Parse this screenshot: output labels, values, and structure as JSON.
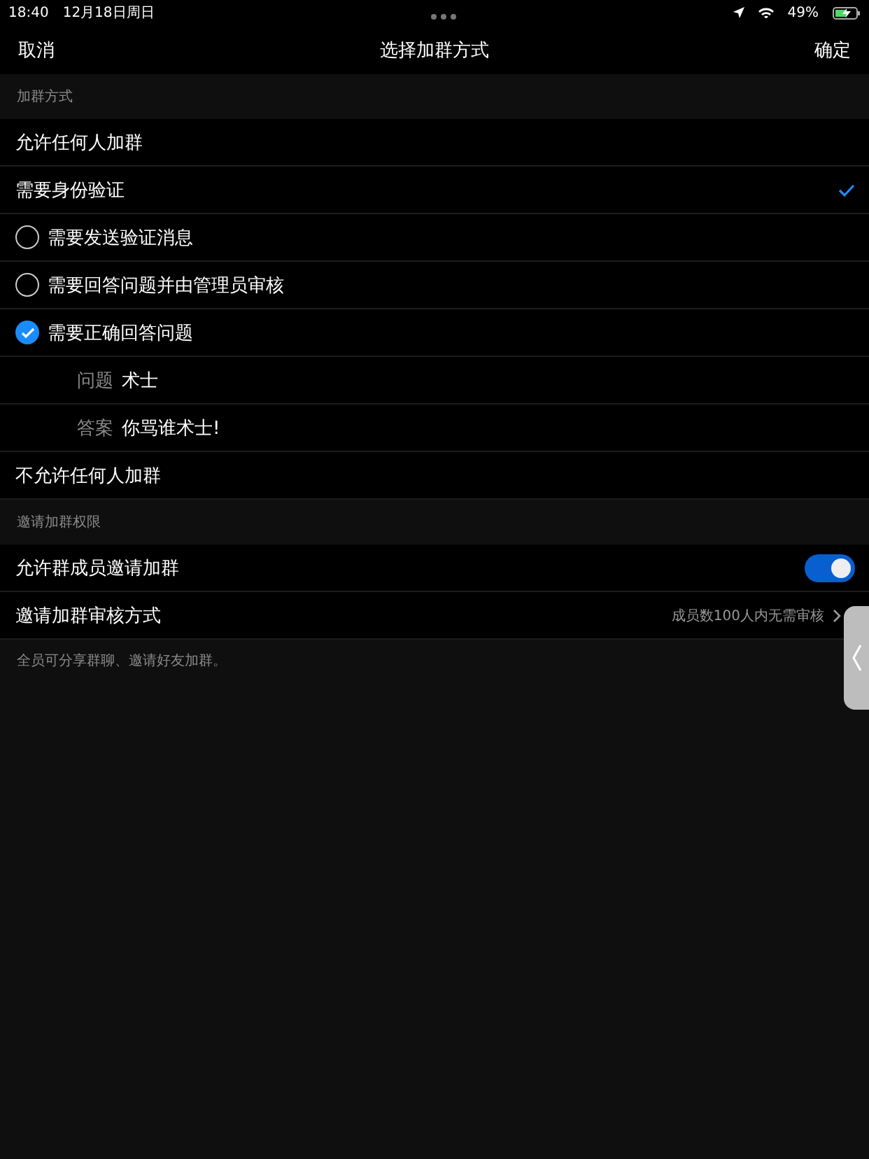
{
  "status_bar": {
    "time": "18:40",
    "date": "12月18日周日",
    "battery": "49%"
  },
  "nav": {
    "cancel": "取消",
    "title": "选择加群方式",
    "confirm": "确定"
  },
  "join_section": {
    "header": "加群方式",
    "options": [
      {
        "label": "允许任何人加群",
        "selected": false
      },
      {
        "label": "需要身份验证",
        "selected": true,
        "sub_options": [
          {
            "label": "需要发送验证消息",
            "selected": false
          },
          {
            "label": "需要回答问题并由管理员审核",
            "selected": false
          },
          {
            "label": "需要正确回答问题",
            "selected": true,
            "fields": [
              {
                "label": "问题",
                "value": "术士"
              },
              {
                "label": "答案",
                "value": "你骂谁术士!"
              }
            ]
          }
        ]
      },
      {
        "label": "不允许任何人加群",
        "selected": false
      }
    ]
  },
  "invite_section": {
    "header": "邀请加群权限",
    "toggle": {
      "label": "允许群成员邀请加群",
      "on": true
    },
    "review": {
      "label": "邀请加群审核方式",
      "value": "成员数100人内无需审核"
    },
    "note": "全员可分享群聊、邀请好友加群。"
  }
}
